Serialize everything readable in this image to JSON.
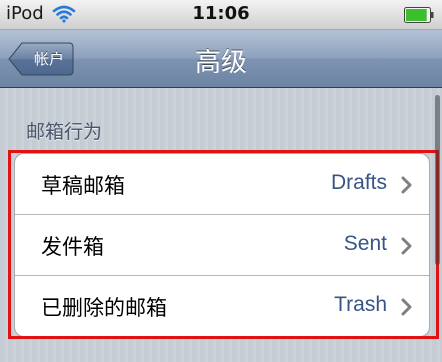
{
  "status_bar": {
    "carrier": "iPod",
    "time": "11:06",
    "wifi_icon": "wifi-icon",
    "battery_icon": "battery-icon",
    "battery_level": 0.9,
    "battery_color": "#3cbf2d"
  },
  "nav_bar": {
    "back_label": "帐户",
    "title": "高级"
  },
  "section": {
    "header": "邮箱行为",
    "rows": [
      {
        "label": "草稿邮箱",
        "value": "Drafts",
        "icon": "chevron-right-icon"
      },
      {
        "label": "发件箱",
        "value": "Sent",
        "icon": "chevron-right-icon"
      },
      {
        "label": "已删除的邮箱",
        "value": "Trash",
        "icon": "chevron-right-icon"
      }
    ]
  },
  "colors": {
    "navbar": "#7d93b1",
    "value_text": "#385487",
    "highlight": "#e01212",
    "background": "#c5ccd4"
  }
}
